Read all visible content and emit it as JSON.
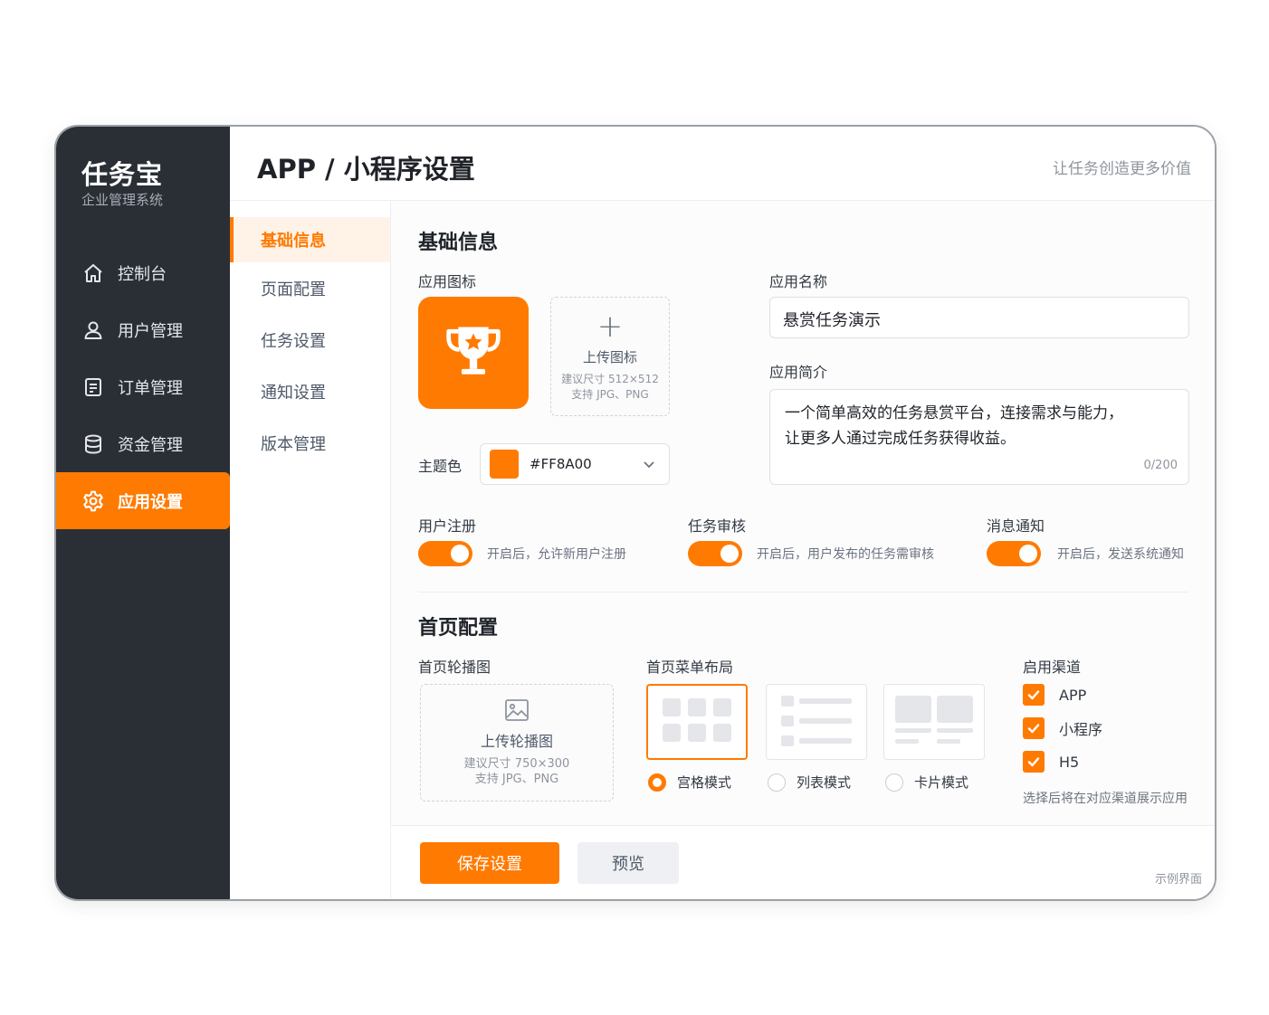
{
  "brand": {
    "title": "任务宝",
    "subtitle": "企业管理系统"
  },
  "sidebar": {
    "items": [
      {
        "label": "控制台",
        "icon": "home-icon"
      },
      {
        "label": "用户管理",
        "icon": "user-icon"
      },
      {
        "label": "订单管理",
        "icon": "document-icon"
      },
      {
        "label": "资金管理",
        "icon": "database-icon"
      },
      {
        "label": "应用设置",
        "icon": "gear-icon",
        "active": true
      }
    ]
  },
  "header": {
    "title": "APP / 小程序设置",
    "slogan": "让任务创造更多价值"
  },
  "subnav": {
    "items": [
      "基础信息",
      "页面配置",
      "任务设置",
      "通知设置",
      "版本管理"
    ],
    "active": "基础信息"
  },
  "basic": {
    "section_title": "基础信息",
    "icon_label": "应用图标",
    "icon_name": "trophy-icon",
    "upload_icon": {
      "title": "上传图标",
      "hint1": "建议尺寸 512×512",
      "hint2": "支持 JPG、PNG"
    },
    "theme_label": "主题色",
    "theme_color": "#FF8A00",
    "name_label": "应用名称",
    "name_value": "悬赏任务演示",
    "desc_label": "应用简介",
    "desc_line1": "一个简单高效的任务悬赏平台，连接需求与能力，",
    "desc_line2": "让更多人通过完成任务获得收益。",
    "desc_counter": "0/200"
  },
  "toggles": [
    {
      "label": "用户注册",
      "hint": "开启后，允许新用户注册",
      "on": true
    },
    {
      "label": "任务审核",
      "hint": "开启后，用户发布的任务需审核",
      "on": true
    },
    {
      "label": "消息通知",
      "hint": "开启后，发送系统通知",
      "on": true
    }
  ],
  "home": {
    "section_title": "首页配置",
    "banner_label": "首页轮播图",
    "upload_banner": {
      "title": "上传轮播图",
      "hint1": "建议尺寸 750×300",
      "hint2": "支持 JPG、PNG"
    },
    "layout_label": "首页菜单布局",
    "layouts": [
      {
        "label": "宫格模式",
        "selected": true
      },
      {
        "label": "列表模式",
        "selected": false
      },
      {
        "label": "卡片模式",
        "selected": false
      }
    ],
    "channels_label": "启用渠道",
    "channels": [
      {
        "label": "APP",
        "checked": true
      },
      {
        "label": "小程序",
        "checked": true
      },
      {
        "label": "H5",
        "checked": true
      }
    ],
    "channels_hint": "选择后将在对应渠道展示应用"
  },
  "footer": {
    "save_label": "保存设置",
    "preview_label": "预览",
    "sample_note": "示例界面"
  },
  "colors": {
    "accent": "#FF7A00",
    "sidebar_bg": "#2A2F36"
  }
}
